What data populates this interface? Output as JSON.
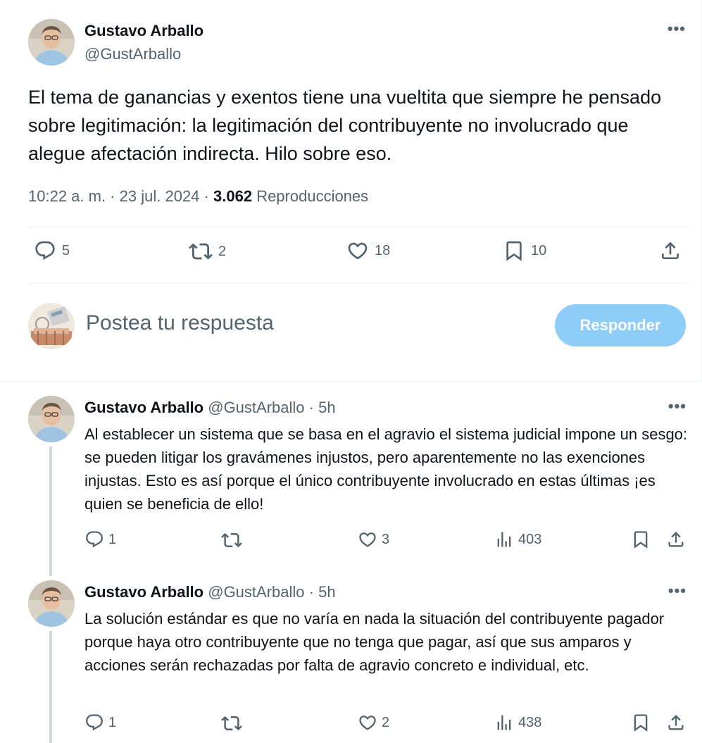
{
  "main_tweet": {
    "author_name": "Gustavo Arballo",
    "author_handle": "@GustArballo",
    "more_label": "•••",
    "text": "El tema de ganancias y exentos tiene una vueltita que siempre he pensado sobre legitimación: la legitimación del contribuyente no involucrado que alegue afectación indirecta. Hilo sobre eso.",
    "time": "10:22 a. m.",
    "dot": "·",
    "date": "23 jul. 2024",
    "views_count": "3.062",
    "views_label": "Reproducciones",
    "actions": {
      "replies": "5",
      "retweets": "2",
      "likes": "18",
      "bookmarks": "10"
    }
  },
  "compose": {
    "placeholder": "Postea tu respuesta",
    "button_label": "Responder"
  },
  "replies": [
    {
      "author_name": "Gustavo Arballo",
      "author_handle": "@GustArballo",
      "dot": "·",
      "time": "5h",
      "more_label": "•••",
      "text": "Al establecer un sistema que se basa en el agravio el sistema judicial impone un sesgo: se pueden litigar los gravámenes injustos, pero aparentemente no las exenciones injustas. Esto es así porque el único contribuyente involucrado en estas últimas ¡es quien se beneficia de ello!",
      "replies": "1",
      "likes": "3",
      "views": "403"
    },
    {
      "author_name": "Gustavo Arballo",
      "author_handle": "@GustArballo",
      "dot": "·",
      "time": "5h",
      "more_label": "•••",
      "text": "La solución estándar es que no varía en nada la situación del contribuyente pagador porque haya otro contribuyente que no tenga que pagar, así que sus amparos y acciones serán rechazadas por falta de agravio concreto e individual, etc.",
      "replies": "1",
      "likes": "2",
      "views": "438"
    }
  ],
  "colors": {
    "text": "#0f1419",
    "secondary": "#536471",
    "divider": "#eff3f4",
    "button_disabled": "#8ecdf7"
  }
}
